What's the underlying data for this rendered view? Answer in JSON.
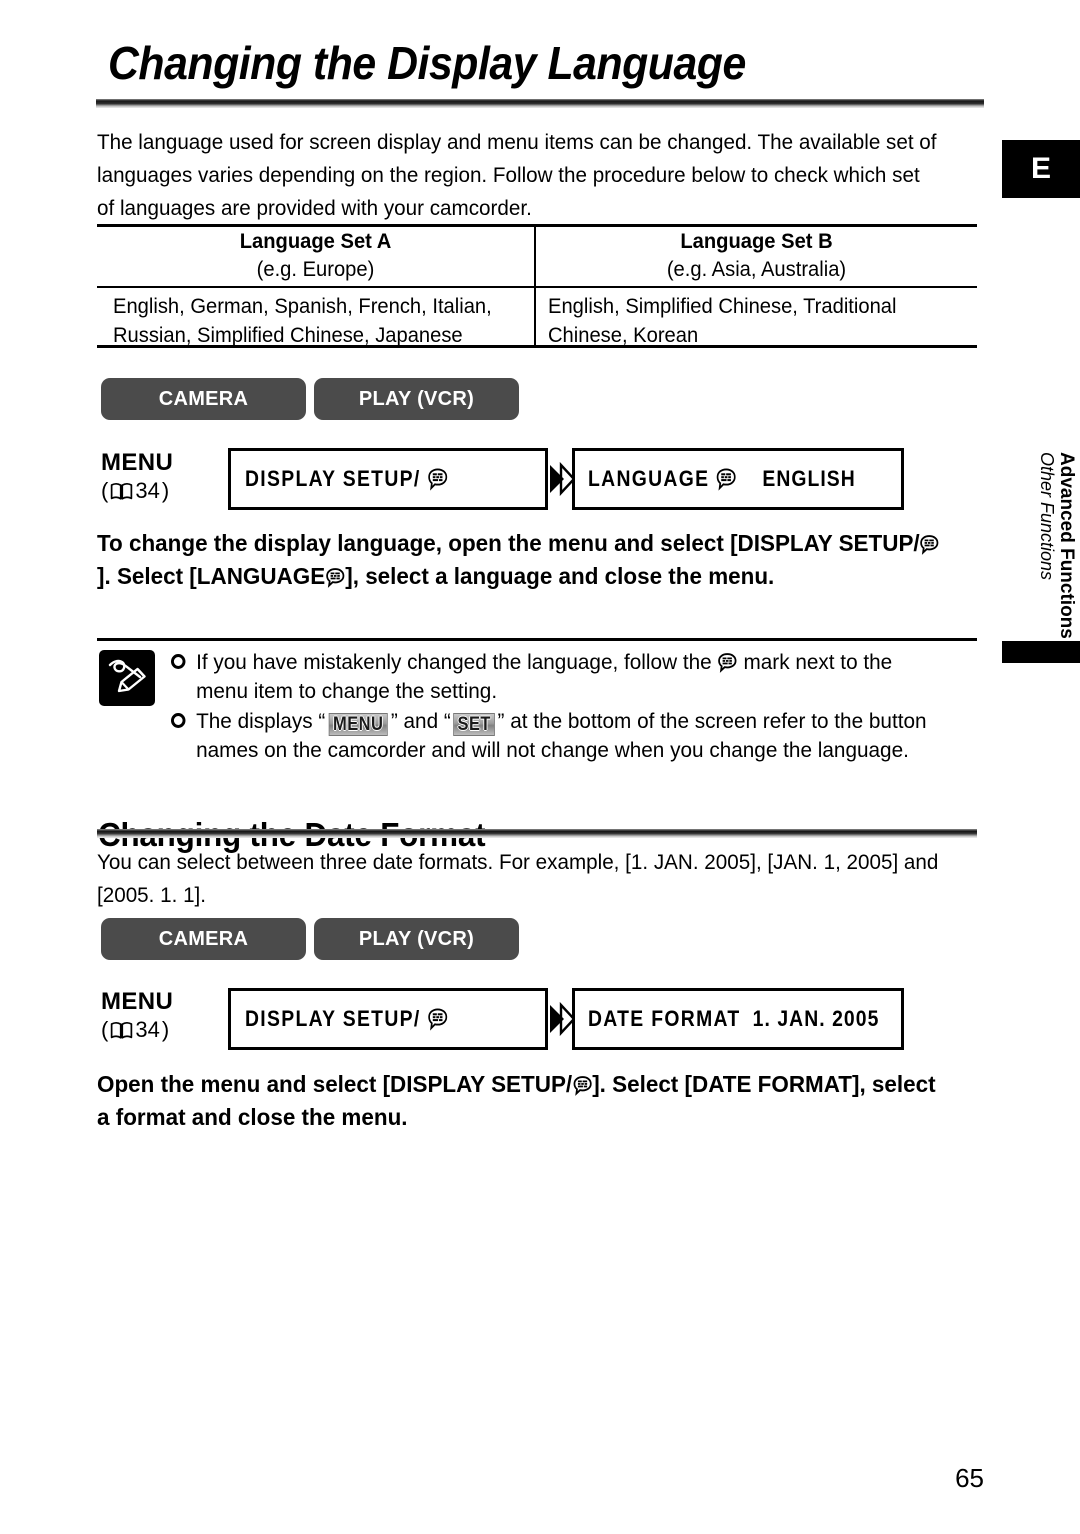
{
  "page": {
    "title": "Changing the Display Language",
    "number": "65",
    "section_tab": "E",
    "side_tab": {
      "primary": "Advanced Functions",
      "secondary": "Other Functions"
    }
  },
  "intro": {
    "paragraph": "The language used for screen display and menu items can be changed. The available set of languages varies depending on the region. Follow the procedure below to check which set of languages are provided with your camcorder."
  },
  "language_table": {
    "columns": [
      {
        "header": "Language Set A",
        "subheader": "(e.g. Europe)",
        "body": "English, German, Spanish, French, Italian, Russian, Simplified Chinese, Japanese"
      },
      {
        "header": "Language Set B",
        "subheader": "(e.g. Asia, Australia)",
        "body": "English, Simplified Chinese, Traditional Chinese, Korean"
      }
    ]
  },
  "procedure_language": {
    "modes": {
      "camera": "CAMERA",
      "play": "PLAY (VCR)"
    },
    "menu_ref": {
      "word": "MENU",
      "open_paren": "(",
      "page": "34",
      "close_paren": ")"
    },
    "steps": [
      {
        "label": "DISPLAY SETUP/",
        "icon": "speech-bubble-icon",
        "value": ""
      },
      {
        "label": "LANGUAGE",
        "icon": "speech-bubble-icon",
        "value": "ENGLISH"
      }
    ],
    "instruction": "To change the display language, open the menu and select [DISPLAY SETUP/@]. Select [LANGUAGE@], select a language and close the menu.",
    "instruction_parts": {
      "a": "To change the display language, open the menu and select [DISPLAY SETUP/",
      "b": "]. Select [LANGUAGE",
      "c": "], select a language and close the menu."
    }
  },
  "notes": {
    "items": [
      {
        "before": "If you have mistakenly changed the language, follow the ",
        "after": " mark next to the menu item to change the setting."
      },
      {
        "p1": "The displays “",
        "badge1": "MENU",
        "p2": "” and “",
        "badge2": "SET",
        "p3": "” at the bottom of the screen refer to the button names on the camcorder and will not change when you change the language."
      }
    ]
  },
  "date_section": {
    "heading": "Changing the Date Format",
    "paragraph": "You can select between three date formats. For example, [1. JAN. 2005], [JAN. 1, 2005] and [2005. 1. 1].",
    "modes": {
      "camera": "CAMERA",
      "play": "PLAY (VCR)"
    },
    "menu_ref": {
      "word": "MENU",
      "open_paren": "(",
      "page": "34",
      "close_paren": ")"
    },
    "steps": [
      {
        "label": "DISPLAY SETUP/",
        "icon": "speech-bubble-icon",
        "value": ""
      },
      {
        "label": "DATE FORMAT",
        "icon": "",
        "value": "1. JAN. 2005"
      }
    ],
    "instruction_parts": {
      "a": "Open the menu and select [DISPLAY SETUP/",
      "b": "]. Select [DATE FORMAT], select a format and close the menu."
    }
  },
  "colors": {
    "mode_button_bg": "#4b4b4b",
    "mode_button_text": "#ffffff",
    "tab_bg": "#000000",
    "rule": "#000000"
  }
}
